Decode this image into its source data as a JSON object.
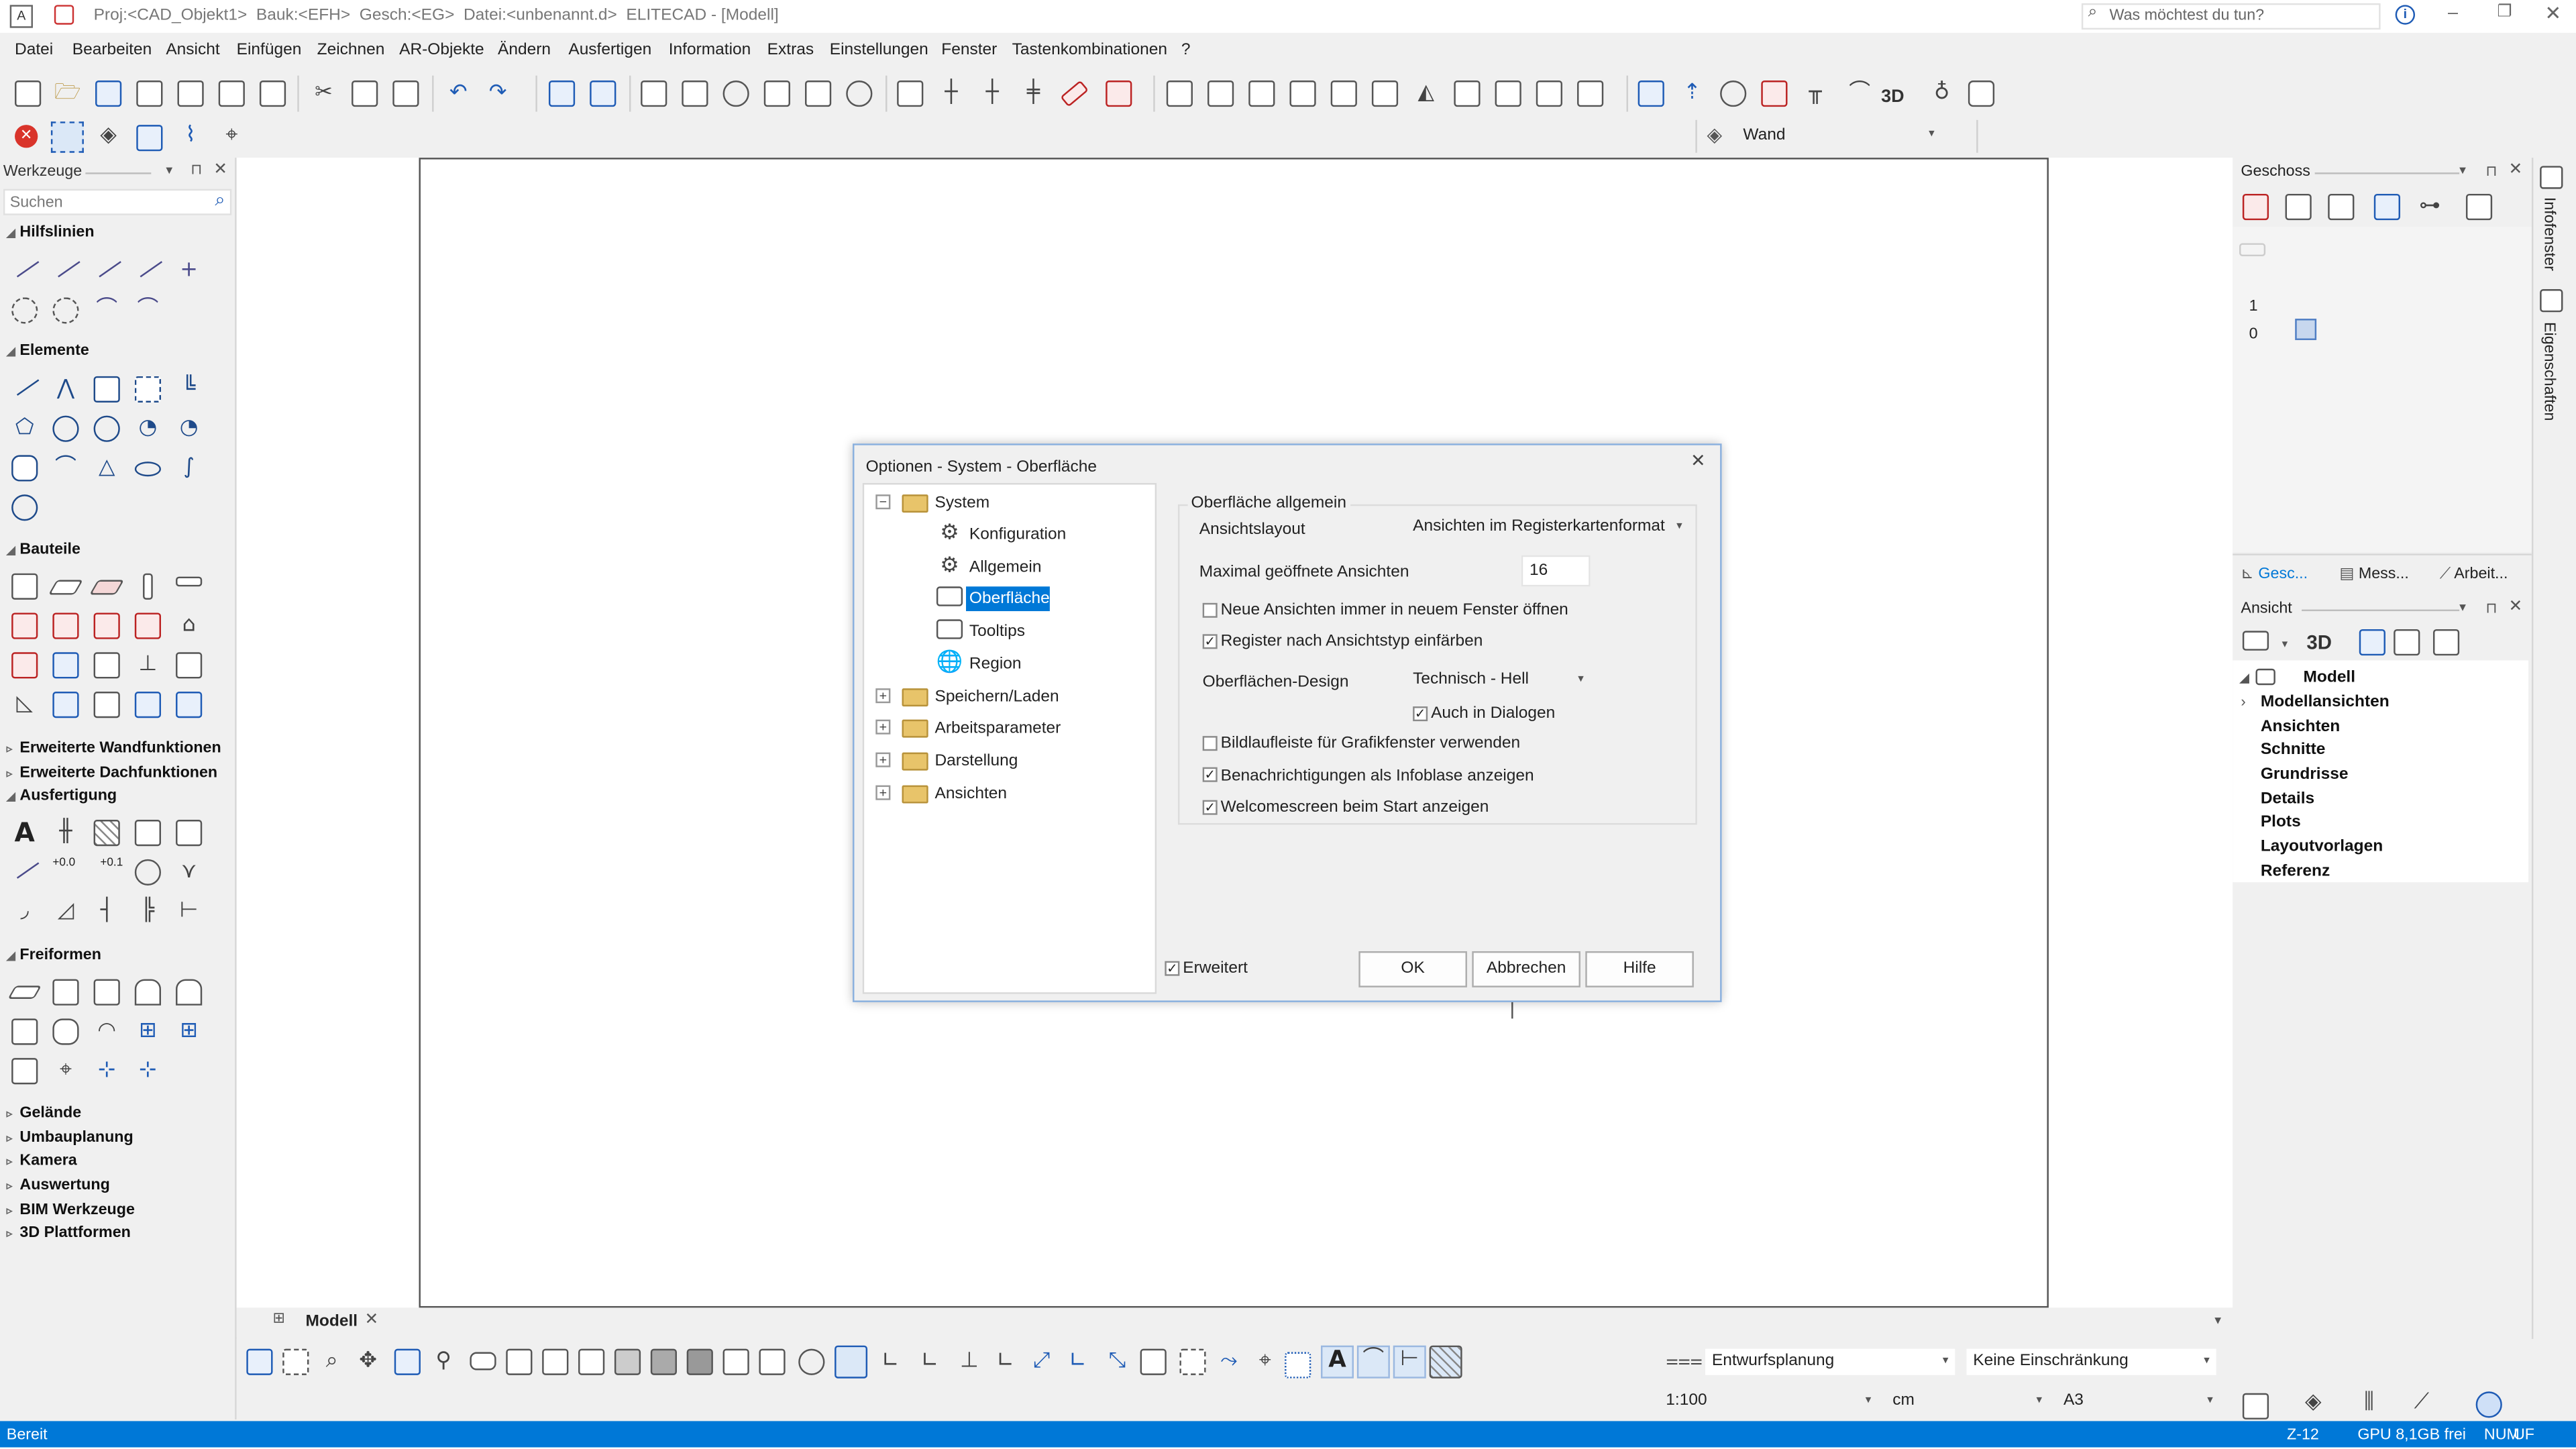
{
  "title_bar": {
    "project": "Proj:<CAD_Objekt1>",
    "building": "Bauk:<EFH>",
    "floor": "Gesch:<EG>",
    "file": "Datei:<unbenannt.d>",
    "app": "ELITECAD - [Modell]",
    "search_placeholder": "Was möchtest du tun?"
  },
  "menu": [
    "Datei",
    "Bearbeiten",
    "Ansicht",
    "Einfügen",
    "Zeichnen",
    "AR-Objekte",
    "Ändern",
    "Ausfertigen",
    "Information",
    "Extras",
    "Einstellungen",
    "Fenster",
    "Tastenkombinationen",
    "?"
  ],
  "layer_combo": {
    "value": "Wand"
  },
  "left_panel": {
    "title": "Werkzeuge",
    "search_placeholder": "Suchen",
    "sections": {
      "hilfslinien": "Hilfslinien",
      "elemente": "Elemente",
      "bauteile": "Bauteile",
      "erw_wand": "Erweiterte Wandfunktionen",
      "erw_dach": "Erweiterte Dachfunktionen",
      "ausfertigung": "Ausfertigung",
      "freiformen": "Freiformen",
      "gelaende": "Gelände",
      "umbau": "Umbauplanung",
      "kamera": "Kamera",
      "auswertung": "Auswertung",
      "bim": "BIM Werkzeuge",
      "plattformen": "3D Plattformen"
    },
    "ausfertigung_labels": {
      "plus_zero": "+0.0",
      "plus_one": "+0.1"
    }
  },
  "right_panel": {
    "geschoss_title": "Geschoss",
    "floor_levels": [
      "1",
      "0"
    ],
    "tabs": [
      "Gesc...",
      "Mess...",
      "Arbeit..."
    ],
    "ansicht_title": "Ansicht",
    "ansicht_3d": "3D",
    "tree_root": "Modell",
    "tree_items": [
      "Modellansichten",
      "Ansichten",
      "Schnitte",
      "Grundrisse",
      "Details",
      "Plots",
      "Layoutvorlagen",
      "Referenz"
    ],
    "side_tabs": [
      "Infofenster",
      "Eigenschaften"
    ]
  },
  "canvas": {
    "tab_label": "Modell"
  },
  "toolbar_3d_label": "3D",
  "dialog": {
    "title": "Optionen - System - Oberfläche",
    "tree": {
      "system": "System",
      "children": [
        "Konfiguration",
        "Allgemein",
        "Oberfläche",
        "Tooltips",
        "Region"
      ],
      "others": [
        "Speichern/Laden",
        "Arbeitsparameter",
        "Darstellung",
        "Ansichten"
      ]
    },
    "group_title": "Oberfläche allgemein",
    "ansichtslayout_label": "Ansichtslayout",
    "ansichtslayout_value": "Ansichten im Registerkartenformat",
    "max_views_label": "Maximal geöffnete Ansichten",
    "max_views_value": "16",
    "cb_new_window": {
      "label": "Neue Ansichten immer in neuem Fenster öffnen",
      "checked": false
    },
    "cb_color_tabs": {
      "label": "Register nach Ansichtstyp einfärben",
      "checked": true
    },
    "design_label": "Oberflächen-Design",
    "design_value": "Technisch - Hell",
    "cb_dialogs": {
      "label": "Auch in Dialogen",
      "checked": true
    },
    "cb_scrollbar": {
      "label": "Bildlaufleiste für Grafikfenster verwenden",
      "checked": false
    },
    "cb_notify": {
      "label": "Benachrichtigungen als Infoblase anzeigen",
      "checked": true
    },
    "cb_welcome": {
      "label": "Welcomescreen beim Start anzeigen",
      "checked": true
    },
    "cb_advanced": {
      "label": "Erweitert",
      "checked": true
    },
    "buttons": {
      "ok": "OK",
      "cancel": "Abbrechen",
      "help": "Hilfe"
    }
  },
  "bottom_combos": {
    "phase": "Entwurfsplanung",
    "restriction": "Keine Einschränkung",
    "scale": "1:100",
    "unit": "cm",
    "paper": "A3"
  },
  "status_bar": {
    "left": "Bereit",
    "zoom": "Z-12",
    "gpu": "GPU 8,1GB frei",
    "num": "NUM",
    "uf": "UF"
  },
  "colors": {
    "accent": "#0078d7",
    "status_bar": "#0078d7",
    "selection": "#0078d7"
  }
}
